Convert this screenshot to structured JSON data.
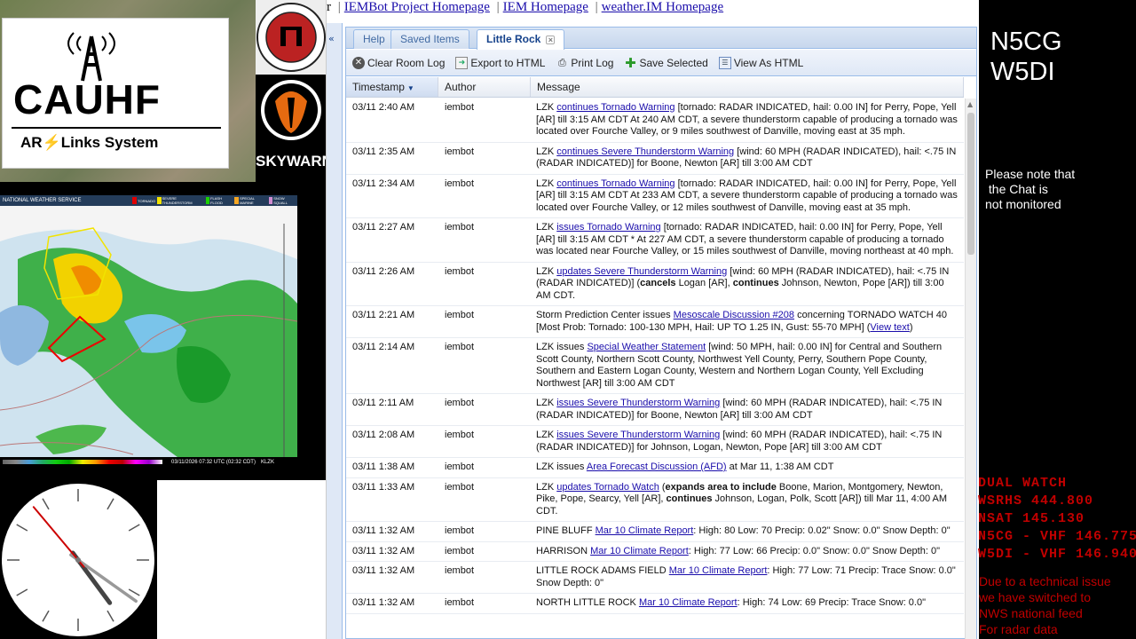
{
  "logos": {
    "cauhf_text": "CAUHF",
    "cauhf_sub_prefix": "AR",
    "cauhf_sub_suffix": "Links System",
    "skywarn_label": "SKYWARN"
  },
  "radar": {
    "header_title": "NATIONAL WEATHER SERVICE",
    "legend": [
      {
        "label": "TORNADO",
        "color": "#e00000"
      },
      {
        "label": "SEVERE THUNDERSTORM",
        "color": "#f2e300"
      },
      {
        "label": "FLASH FLOOD",
        "color": "#1cd000"
      },
      {
        "label": "SPECIAL MARINE",
        "color": "#f5a623"
      },
      {
        "label": "SNOW SQUALL",
        "color": "#d08cd0"
      }
    ],
    "timestamp": "03/11/2026 07:32 UTC (02:32 CDT)",
    "station": "KLZK"
  },
  "nav": {
    "links": [
      "IEMBot Project Homepage",
      "IEM Homepage",
      "weather.IM Homepage"
    ],
    "lead": "r"
  },
  "tabs": [
    {
      "label": "Help",
      "active": false
    },
    {
      "label": "Saved Items",
      "active": false
    },
    {
      "label": "Little Rock",
      "active": true
    }
  ],
  "toolbar": {
    "clear": "Clear Room Log",
    "export": "Export to HTML",
    "print": "Print Log",
    "save": "Save Selected",
    "view": "View As HTML"
  },
  "grid": {
    "headers": {
      "timestamp": "Timestamp",
      "author": "Author",
      "message": "Message"
    },
    "rows": [
      {
        "ts": "03/11 2:40 AM",
        "author": "iembot",
        "html": "LZK <a>continues Tornado Warning</a> [tornado: RADAR INDICATED, hail: 0.00 IN] for Perry, Pope, Yell [AR] till 3:15 AM CDT At 240 AM CDT, a severe thunderstorm capable of producing a tornado was located over Fourche Valley, or 9 miles southwest of Danville, moving east at 35 mph."
      },
      {
        "ts": "03/11 2:35 AM",
        "author": "iembot",
        "html": "LZK <a>continues Severe Thunderstorm Warning</a> [wind: 60 MPH (RADAR INDICATED), hail: &lt;.75 IN (RADAR INDICATED)] for Boone, Newton [AR] till 3:00 AM CDT"
      },
      {
        "ts": "03/11 2:34 AM",
        "author": "iembot",
        "html": "LZK <a>continues Tornado Warning</a> [tornado: RADAR INDICATED, hail: 0.00 IN] for Perry, Pope, Yell [AR] till 3:15 AM CDT At 233 AM CDT, a severe thunderstorm capable of producing a tornado was located over Fourche Valley, or 12 miles southwest of Danville, moving east at 35 mph."
      },
      {
        "ts": "03/11 2:27 AM",
        "author": "iembot",
        "html": "LZK <a>issues Tornado Warning</a> [tornado: RADAR INDICATED, hail: 0.00 IN] for Perry, Pope, Yell [AR] till 3:15 AM CDT * At 227 AM CDT, a severe thunderstorm capable of producing a tornado was located near Fourche Valley, or 15 miles southwest of Danville, moving northeast at 40 mph."
      },
      {
        "ts": "03/11 2:26 AM",
        "author": "iembot",
        "html": "LZK <a>updates Severe Thunderstorm Warning</a> [wind: 60 MPH (RADAR INDICATED), hail: &lt;.75 IN (RADAR INDICATED)] (<b>cancels</b> Logan [AR], <b>continues</b> Johnson, Newton, Pope [AR]) till 3:00 AM CDT."
      },
      {
        "ts": "03/11 2:21 AM",
        "author": "iembot",
        "html": "Storm Prediction Center issues <a>Mesoscale Discussion #208</a> concerning TORNADO WATCH 40 [Most Prob: Tornado: 100-130 MPH, Hail: UP TO 1.25 IN, Gust: 55-70 MPH] (<a>View text</a>)"
      },
      {
        "ts": "03/11 2:14 AM",
        "author": "iembot",
        "html": "LZK issues <a>Special Weather Statement</a> [wind: 50 MPH, hail: 0.00 IN] for Central and Southern Scott County, Northern Scott County, Northwest Yell County, Perry, Southern Pope County, Southern and Eastern Logan County, Western and Northern Logan County, Yell Excluding Northwest [AR] till 3:00 AM CDT"
      },
      {
        "ts": "03/11 2:11 AM",
        "author": "iembot",
        "html": "LZK <a>issues Severe Thunderstorm Warning</a> [wind: 60 MPH (RADAR INDICATED), hail: &lt;.75 IN (RADAR INDICATED)] for Boone, Newton [AR] till 3:00 AM CDT"
      },
      {
        "ts": "03/11 2:08 AM",
        "author": "iembot",
        "html": "LZK <a>issues Severe Thunderstorm Warning</a> [wind: 60 MPH (RADAR INDICATED), hail: &lt;.75 IN (RADAR INDICATED)] for Johnson, Logan, Newton, Pope [AR] till 3:00 AM CDT"
      },
      {
        "ts": "03/11 1:38 AM",
        "author": "iembot",
        "html": "LZK issues <a>Area Forecast Discussion (AFD)</a> at Mar 11, 1:38 AM CDT"
      },
      {
        "ts": "03/11 1:33 AM",
        "author": "iembot",
        "html": "LZK <a>updates Tornado Watch</a> (<b>expands area to include</b> Boone, Marion, Montgomery, Newton, Pike, Pope, Searcy, Yell [AR], <b>continues</b> Johnson, Logan, Polk, Scott [AR]) till Mar 11, 4:00 AM CDT."
      },
      {
        "ts": "03/11 1:32 AM",
        "author": "iembot",
        "html": "PINE BLUFF <a>Mar 10 Climate Report</a>: High: 80 Low: 70 Precip: 0.02\" Snow: 0.0\" Snow Depth: 0\""
      },
      {
        "ts": "03/11 1:32 AM",
        "author": "iembot",
        "html": "HARRISON <a>Mar 10 Climate Report</a>: High: 77 Low: 66 Precip: 0.0\" Snow: 0.0\" Snow Depth: 0\""
      },
      {
        "ts": "03/11 1:32 AM",
        "author": "iembot",
        "html": "LITTLE ROCK ADAMS FIELD <a>Mar 10 Climate Report</a>: High: 77 Low: 71 Precip: Trace Snow: 0.0\" Snow Depth: 0\""
      },
      {
        "ts": "03/11 1:32 AM",
        "author": "iembot",
        "html": "NORTH LITTLE ROCK <a>Mar 10 Climate Report</a>: High: 74 Low: 69 Precip: Trace Snow: 0.0\""
      }
    ]
  },
  "right": {
    "callsign_1": "N5CG",
    "callsign_2": "W5DI",
    "chat_note": "Please note that\n the Chat is\nnot monitored",
    "dual_watch": "DUAL WATCH\nWSRHS 444.800\nNSAT 145.130\nN5CG - VHF 146.775\nW5DI - VHF 146.940",
    "tech_note": "Due to a technical issue\nwe have switched to\nNWS national feed\nFor radar data"
  },
  "clock": {
    "hour": 2,
    "minute": 47,
    "second": 54
  }
}
